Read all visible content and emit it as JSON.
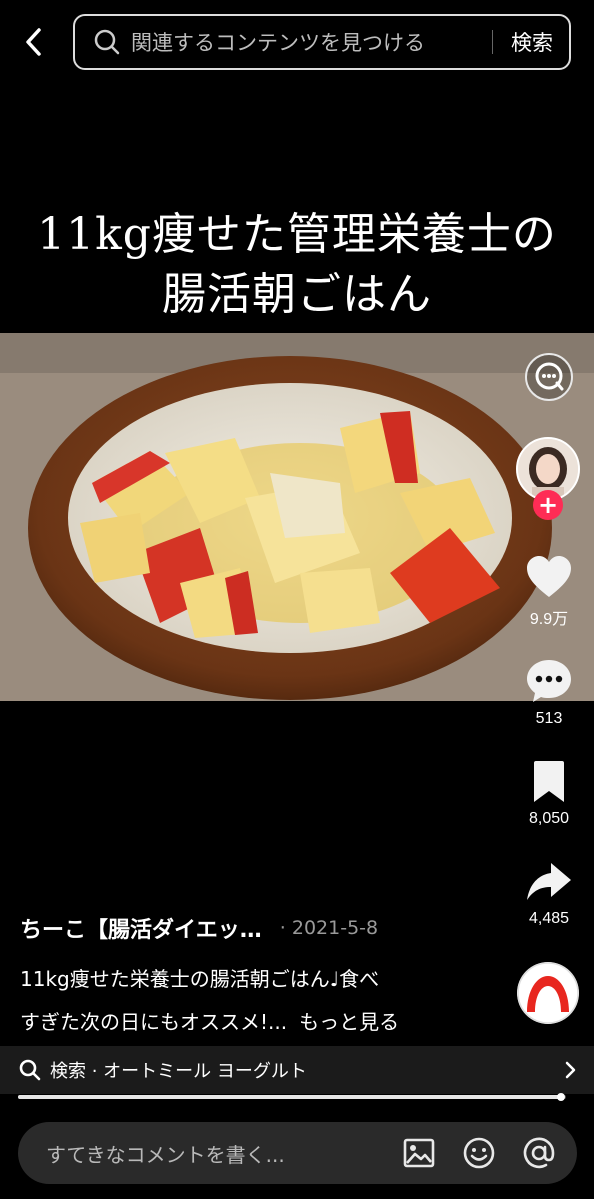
{
  "header": {
    "search_placeholder": "関連するコンテンツを見つける",
    "search_button": "検索"
  },
  "video": {
    "overlay_title_line1": "11kg痩せた管理栄養士の",
    "overlay_title_line2": "腸活朝ごはん"
  },
  "actions": {
    "like_count": "9.9万",
    "comment_count": "513",
    "bookmark_count": "8,050",
    "share_count": "4,485",
    "follow_symbol": "+"
  },
  "post": {
    "author": "ちーこ【腸活ダイエッ…",
    "date": "· 2021-5-8",
    "caption_line1": "11kg痩せた栄養士の腸活朝ごはん♩食べ",
    "caption_line2": "すぎた次の日にもオススメ!...",
    "more_label": "もっと見る"
  },
  "related_search": {
    "text": "検索 · オートミール ヨーグルト",
    "progress": 0.99
  },
  "comment": {
    "placeholder": "すてきなコメントを書く..."
  },
  "colors": {
    "accent": "#fe2c55",
    "background": "#000000"
  },
  "icons": [
    "back-icon",
    "search-icon",
    "chat-bubble-icon",
    "heart-icon",
    "comment-icon",
    "bookmark-icon",
    "share-icon",
    "image-icon",
    "emoji-icon",
    "mention-icon",
    "chevron-right-icon"
  ]
}
